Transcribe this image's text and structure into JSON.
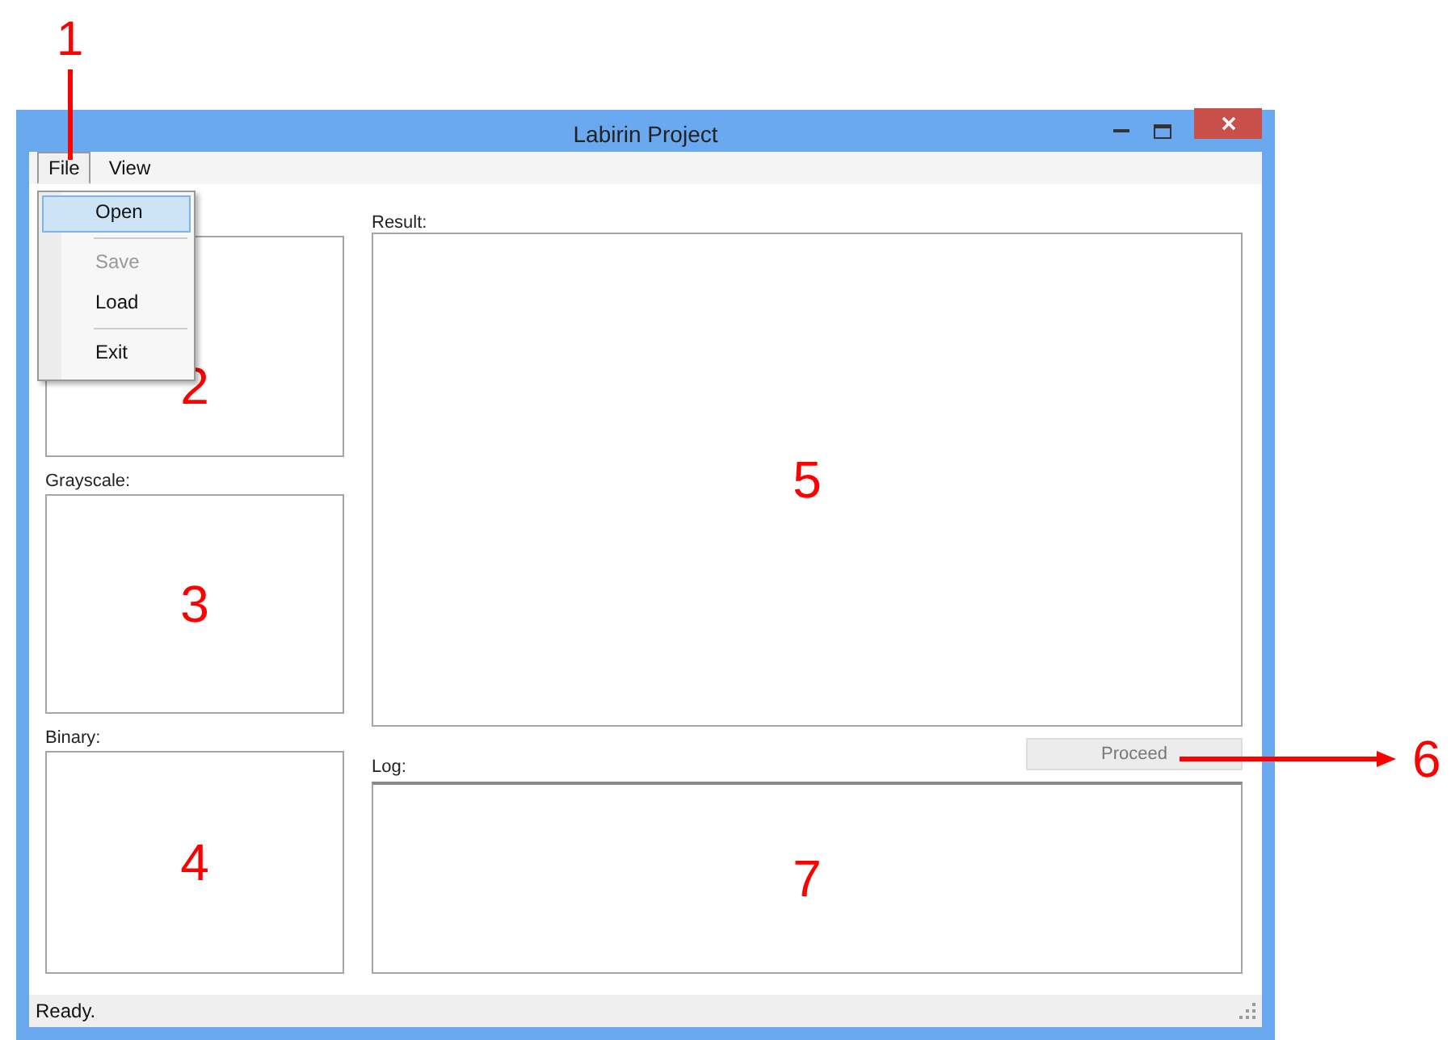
{
  "window": {
    "title": "Labirin Project"
  },
  "menu_bar": [
    {
      "label": "File",
      "selected": true
    },
    {
      "label": "View",
      "selected": false
    }
  ],
  "file_menu": [
    {
      "kind": "item",
      "label": "Open",
      "selected": true,
      "disabled": false
    },
    {
      "kind": "separator"
    },
    {
      "kind": "item",
      "label": "Save",
      "selected": false,
      "disabled": true
    },
    {
      "kind": "item",
      "label": "Load",
      "selected": false,
      "disabled": false
    },
    {
      "kind": "separator"
    },
    {
      "kind": "item",
      "label": "Exit",
      "selected": false,
      "disabled": false
    }
  ],
  "left_panels": [
    {
      "annotation": "2"
    },
    {
      "label": "Grayscale:",
      "annotation": "3"
    },
    {
      "label": "Binary:",
      "annotation": "4"
    }
  ],
  "result": {
    "label": "Result:",
    "annotation": "5"
  },
  "proceed_button": {
    "label": "Proceed",
    "disabled": true,
    "annotation": "6"
  },
  "log": {
    "label": "Log:",
    "annotation": "7"
  },
  "status_bar": {
    "text": "Ready."
  },
  "menu_annotation": {
    "text": "1"
  }
}
